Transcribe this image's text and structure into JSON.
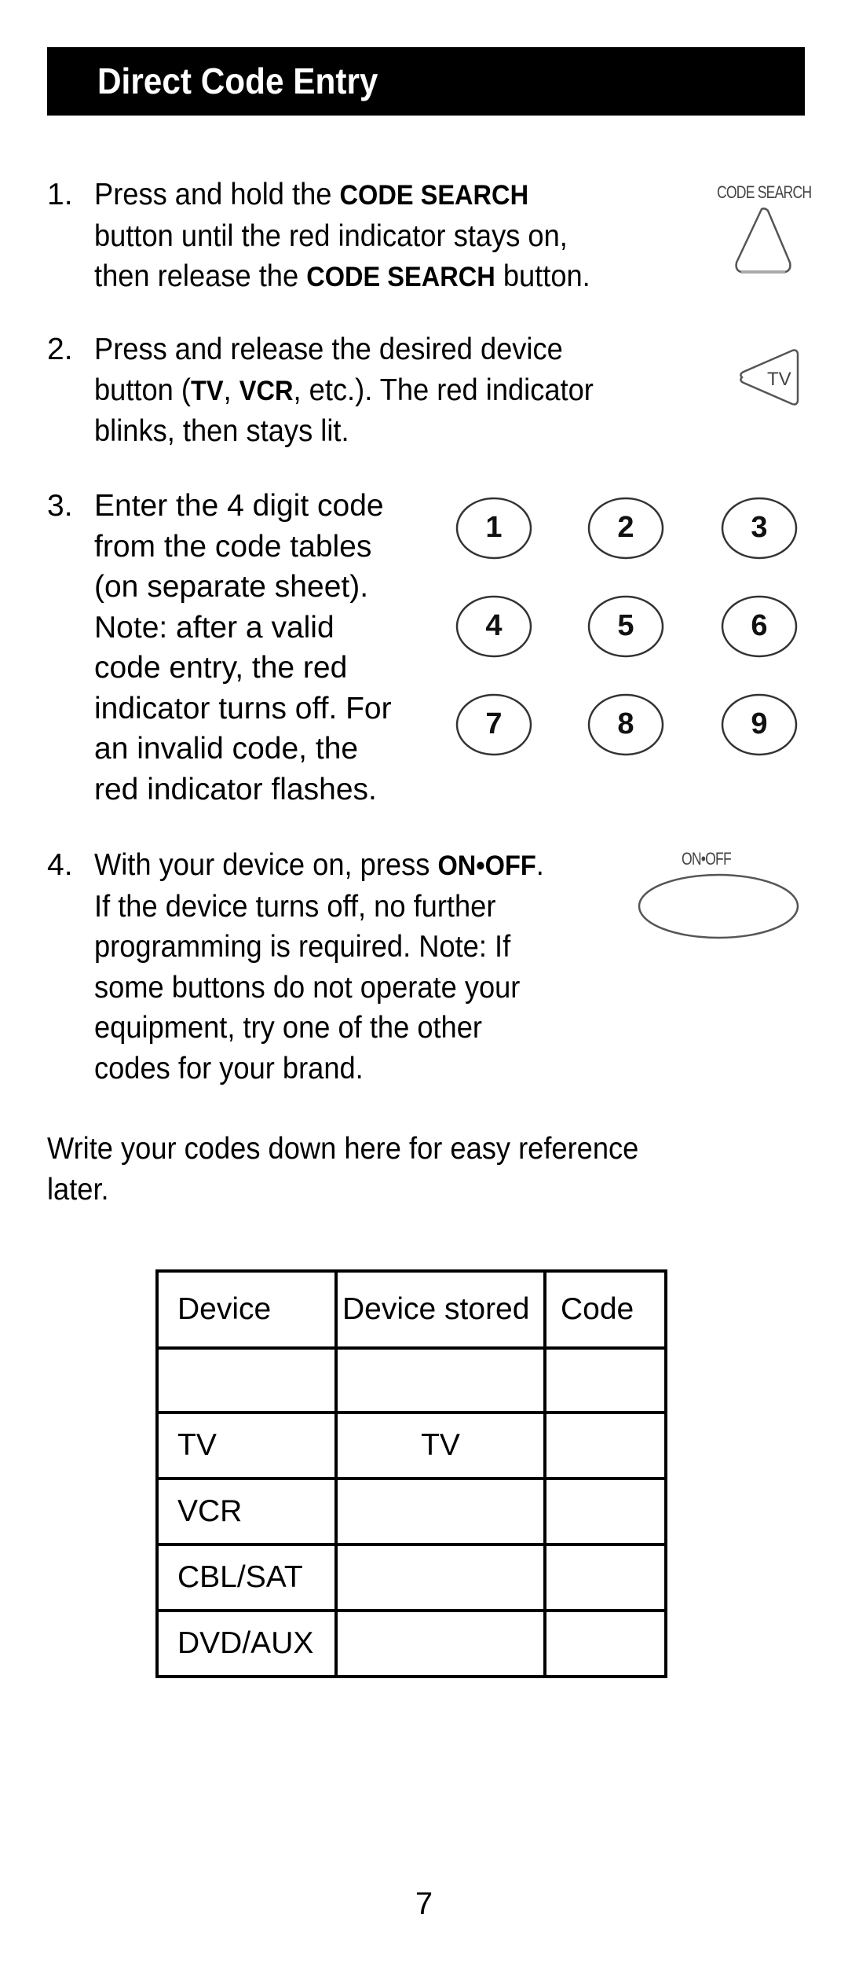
{
  "header": {
    "title": "Direct Code Entry"
  },
  "steps": [
    {
      "number": "1.",
      "lines": [
        {
          "parts": [
            {
              "text": "Press and hold the "
            },
            {
              "text": "CODE SEARCH",
              "bold": true
            }
          ]
        },
        {
          "parts": [
            {
              "text": "button until the red indicator stays on,"
            }
          ]
        },
        {
          "parts": [
            {
              "text": "then release the "
            },
            {
              "text": "CODE SEARCH",
              "bold": true
            },
            {
              "text": " button."
            }
          ]
        }
      ],
      "illustration": {
        "label": "CODE SEARCH",
        "icon": "code-search-triangle-button"
      }
    },
    {
      "number": "2.",
      "lines": [
        {
          "parts": [
            {
              "text": "Press and release the desired device"
            }
          ]
        },
        {
          "parts": [
            {
              "text": "button ("
            },
            {
              "text": "TV",
              "bold": true
            },
            {
              "text": ", "
            },
            {
              "text": "VCR",
              "bold": true
            },
            {
              "text": ", etc.). The red indicator"
            }
          ]
        },
        {
          "parts": [
            {
              "text": "blinks, then stays lit."
            }
          ]
        }
      ],
      "illustration": {
        "label": "TV",
        "icon": "tv-device-button"
      }
    },
    {
      "number": "3.",
      "lines": [
        {
          "parts": [
            {
              "text": "Enter the 4 digit code"
            }
          ]
        },
        {
          "parts": [
            {
              "text": "from the code tables"
            }
          ]
        },
        {
          "parts": [
            {
              "text": "(on separate sheet)."
            }
          ]
        },
        {
          "parts": [
            {
              "text": "Note: after a valid"
            }
          ]
        },
        {
          "parts": [
            {
              "text": "code entry, the red"
            }
          ]
        },
        {
          "parts": [
            {
              "text": "indicator turns off.  For"
            }
          ]
        },
        {
          "parts": [
            {
              "text": "an invalid code, the"
            }
          ]
        },
        {
          "parts": [
            {
              "text": "red indicator flashes."
            }
          ]
        }
      ],
      "illustration": {
        "keypad": [
          "1",
          "2",
          "3",
          "4",
          "5",
          "6",
          "7",
          "8",
          "9"
        ],
        "icon": "number-keypad"
      }
    },
    {
      "number": "4.",
      "lines": [
        {
          "parts": [
            {
              "text": "With your device on, press "
            },
            {
              "text": "ON•OFF",
              "bold": true
            },
            {
              "text": "."
            }
          ]
        },
        {
          "parts": [
            {
              "text": "If the device turns off, no further"
            }
          ]
        },
        {
          "parts": [
            {
              "text": "programming is required. Note: If"
            }
          ]
        },
        {
          "parts": [
            {
              "text": "some buttons do not operate your"
            }
          ]
        },
        {
          "parts": [
            {
              "text": "equipment, try one of the other"
            }
          ]
        },
        {
          "parts": [
            {
              "text": "codes for your brand."
            }
          ]
        }
      ],
      "illustration": {
        "label": "ON•OFF",
        "icon": "power-oval-button"
      }
    }
  ],
  "note": {
    "lines": [
      "Write your codes down here for easy reference",
      "later."
    ]
  },
  "code_table": {
    "headers": [
      "Device",
      "Device stored",
      "Code"
    ],
    "rows": [
      [
        "",
        "",
        ""
      ],
      [
        "TV",
        "TV",
        ""
      ],
      [
        "VCR",
        "",
        ""
      ],
      [
        "CBL/SAT",
        "",
        ""
      ],
      [
        "DVD/AUX",
        "",
        ""
      ]
    ]
  },
  "footer": {
    "page_number": "7"
  }
}
